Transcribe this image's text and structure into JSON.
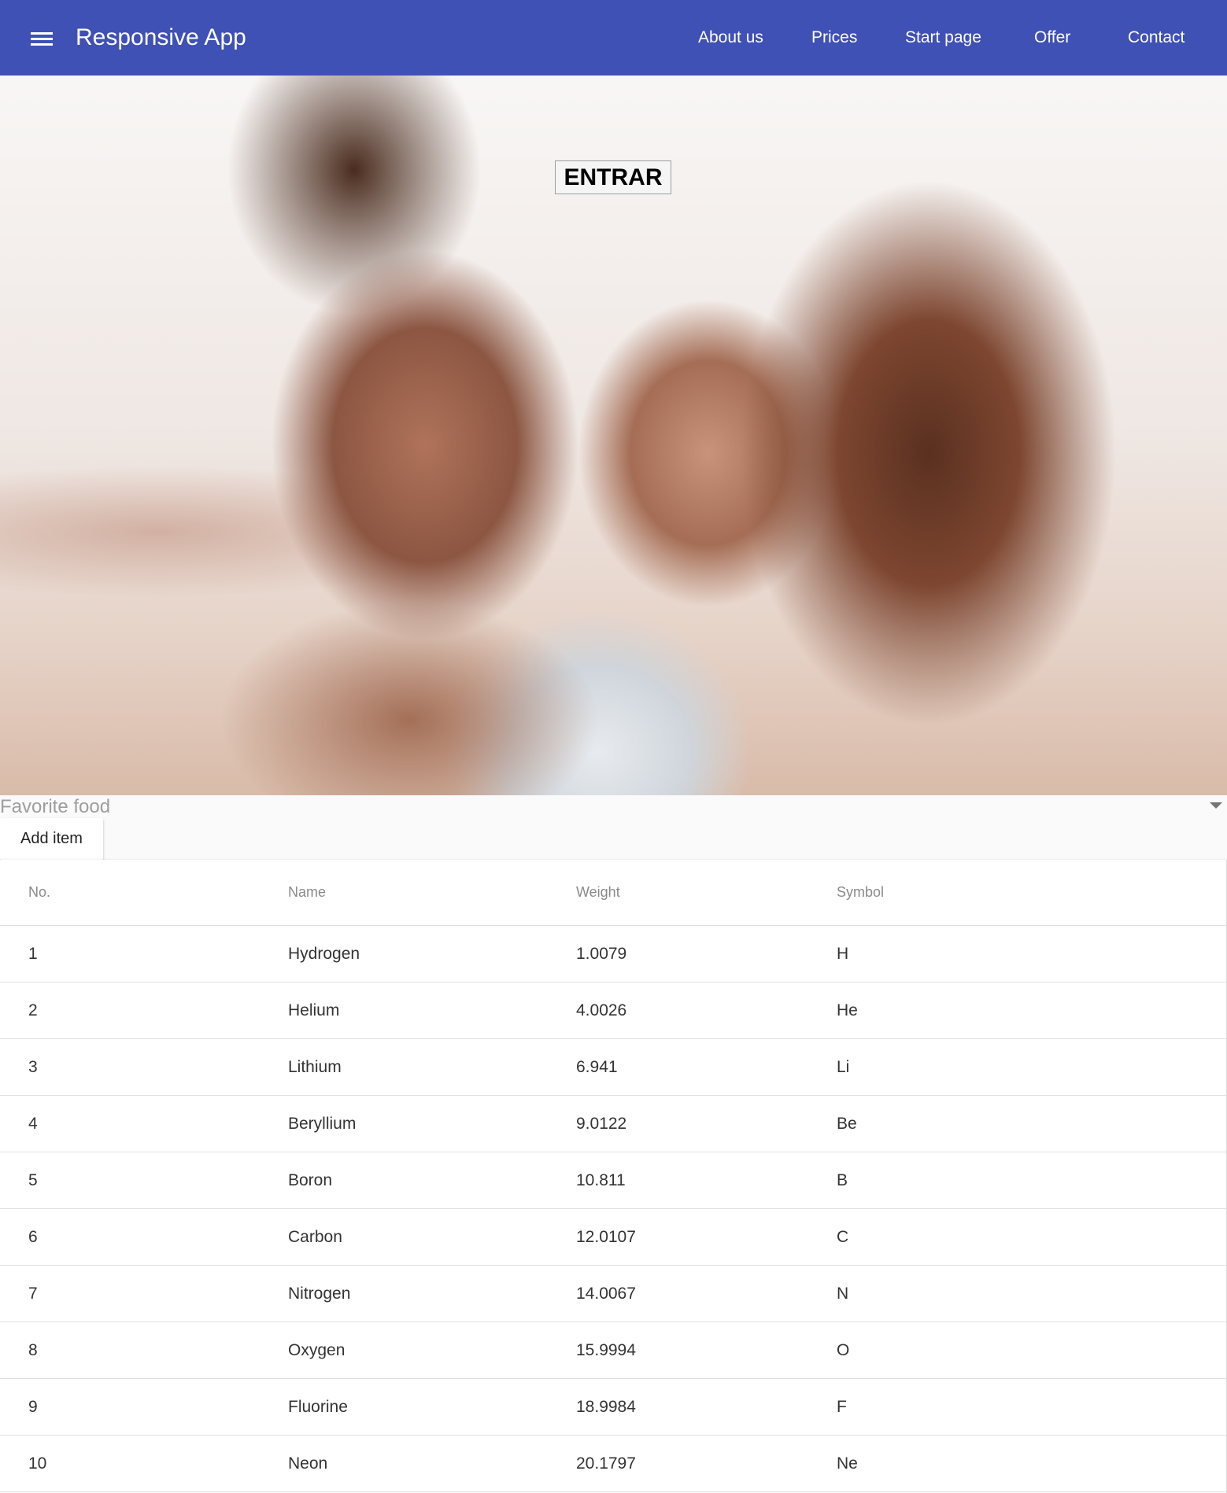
{
  "app_bar": {
    "title": "Responsive App",
    "menu_icon": "hamburger-menu-icon",
    "nav": [
      "About us",
      "Prices",
      "Start page",
      "Offer",
      "Contact"
    ],
    "color": "#3f51b5"
  },
  "hero": {
    "enter_label": "ENTRAR"
  },
  "form": {
    "select_placeholder": "Favorite food",
    "select_icon": "dropdown-arrow-icon",
    "add_item_label": "Add item"
  },
  "table": {
    "headers": [
      "No.",
      "Name",
      "Weight",
      "Symbol"
    ],
    "rows": [
      [
        "1",
        "Hydrogen",
        "1.0079",
        "H"
      ],
      [
        "2",
        "Helium",
        "4.0026",
        "He"
      ],
      [
        "3",
        "Lithium",
        "6.941",
        "Li"
      ],
      [
        "4",
        "Beryllium",
        "9.0122",
        "Be"
      ],
      [
        "5",
        "Boron",
        "10.811",
        "B"
      ],
      [
        "6",
        "Carbon",
        "12.0107",
        "C"
      ],
      [
        "7",
        "Nitrogen",
        "14.0067",
        "N"
      ],
      [
        "8",
        "Oxygen",
        "15.9994",
        "O"
      ],
      [
        "9",
        "Fluorine",
        "18.9984",
        "F"
      ],
      [
        "10",
        "Neon",
        "20.1797",
        "Ne"
      ]
    ]
  }
}
